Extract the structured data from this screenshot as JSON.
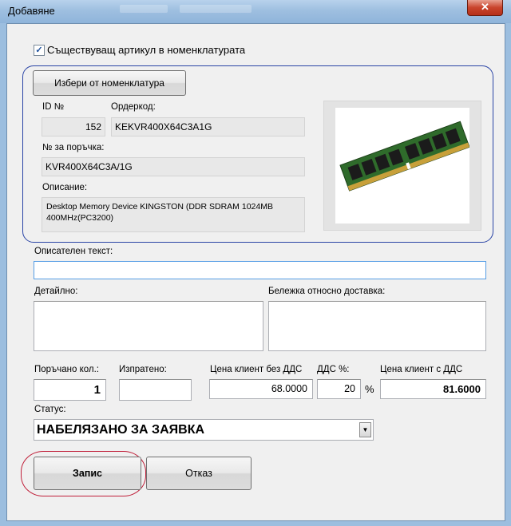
{
  "window": {
    "title": "Добавяне",
    "close_glyph": "✕",
    "close_icon": "close-icon"
  },
  "existing_article": {
    "checked": true,
    "check_glyph": "✓",
    "label": "Съществуващ артикул в номенклатурата"
  },
  "nomenclature": {
    "select_button": "Избери от номенклатура",
    "id_label": "ID №",
    "id_value": "152",
    "ordercode_label": "Ордеркод:",
    "ordercode_value": "KEKVR400X64C3A1G",
    "order_no_label": "№ за поръчка:",
    "order_no_value": "KVR400X64C3A/1G",
    "description_label": "Описание:",
    "description_value": "Desktop Memory Device KINGSTON (DDR SDRAM 1024MB 400MHz(PC3200)",
    "image": "ram-module-image"
  },
  "descriptive_text": {
    "label": "Описателен текст:",
    "value": ""
  },
  "detailed": {
    "label": "Детайлно:",
    "value": ""
  },
  "delivery_note": {
    "label": "Бележка относно доставка:",
    "value": ""
  },
  "ordered_qty": {
    "label": "Поръчано кол.:",
    "value": "1"
  },
  "sent": {
    "label": "Изпратено:",
    "value": ""
  },
  "price_excl_vat": {
    "label": "Цена клиент без ДДС",
    "value": "68.0000"
  },
  "vat_percent": {
    "label": "ДДС %:",
    "value": "20",
    "unit": "%"
  },
  "price_incl_vat": {
    "label": "Цена клиент с ДДС",
    "value": "81.6000"
  },
  "status": {
    "label": "Статус:",
    "selected": "НАБЕЛЯЗАНО ЗА ЗАЯВКА",
    "dropdown_icon": "chevron-down-icon",
    "arrow_glyph": "▼"
  },
  "actions": {
    "save": "Запис",
    "cancel": "Отказ"
  },
  "colors": {
    "group_border": "#2b45a6",
    "highlight_oval": "#c0203a",
    "window_frame": "#9cbedf"
  }
}
